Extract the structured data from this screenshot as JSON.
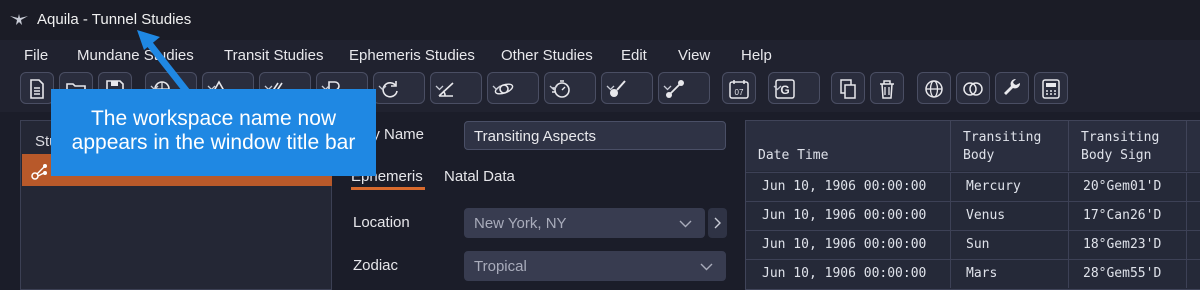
{
  "window": {
    "title": "Aquila - Tunnel Studies"
  },
  "menu": [
    "File",
    "Mundane Studies",
    "Transit Studies",
    "Ephemeris Studies",
    "Other Studies",
    "Edit",
    "View",
    "Help"
  ],
  "toolbar": {
    "buttons": [
      {
        "icon": "new-document-icon"
      },
      {
        "icon": "open-folder-icon"
      },
      {
        "icon": "save-icon"
      },
      {
        "icon": "chart-wheel-icon",
        "dropdown": true
      },
      {
        "icon": "triangle-aspects-icon",
        "dropdown": true
      },
      {
        "icon": "parallel-lines-icon",
        "dropdown": true
      },
      {
        "icon": "planet-glyph-icon",
        "dropdown": true
      },
      {
        "icon": "cycle-icon",
        "dropdown": true
      },
      {
        "icon": "angle-icon",
        "dropdown": true
      },
      {
        "icon": "orbit-icon",
        "dropdown": true
      },
      {
        "icon": "timer-icon",
        "dropdown": true
      },
      {
        "icon": "brush-icon",
        "dropdown": true
      },
      {
        "icon": "connect-nodes-icon",
        "dropdown": true
      },
      {
        "icon": "calendar-icon",
        "text": "07"
      },
      {
        "icon": "g-letter-icon",
        "text": "G",
        "dropdown": true
      },
      {
        "icon": "copy-icon"
      },
      {
        "icon": "trash-icon"
      },
      {
        "icon": "globe-icon"
      },
      {
        "icon": "overlap-circles-icon"
      },
      {
        "icon": "wrench-icon"
      },
      {
        "icon": "calculator-icon"
      }
    ]
  },
  "left_panel": {
    "header_visible": "Stu",
    "selected_item_icon": "aspect-pattern-icon"
  },
  "form": {
    "study_name_label_visible": "dy Name",
    "study_name_value": "Transiting Aspects",
    "tabs": [
      "Ephemeris",
      "Natal Data"
    ],
    "location_label": "Location",
    "location_value": "New York, NY",
    "zodiac_label": "Zodiac",
    "zodiac_value": "Tropical"
  },
  "grid": {
    "headers": [
      "Date Time",
      "Transiting\nBody",
      "Transiting\nBody Sign"
    ],
    "rows": [
      [
        "Jun 10, 1906 00:00:00",
        "Mercury",
        "20°Gem01'D"
      ],
      [
        "Jun 10, 1906 00:00:00",
        "Venus",
        "17°Can26'D"
      ],
      [
        "Jun 10, 1906 00:00:00",
        "Sun",
        "18°Gem23'D"
      ],
      [
        "Jun 10, 1906 00:00:00",
        "Mars",
        "28°Gem55'D"
      ]
    ]
  },
  "callout": {
    "text": "The workspace name now appears in the window title bar",
    "color": "#1f88e3"
  }
}
